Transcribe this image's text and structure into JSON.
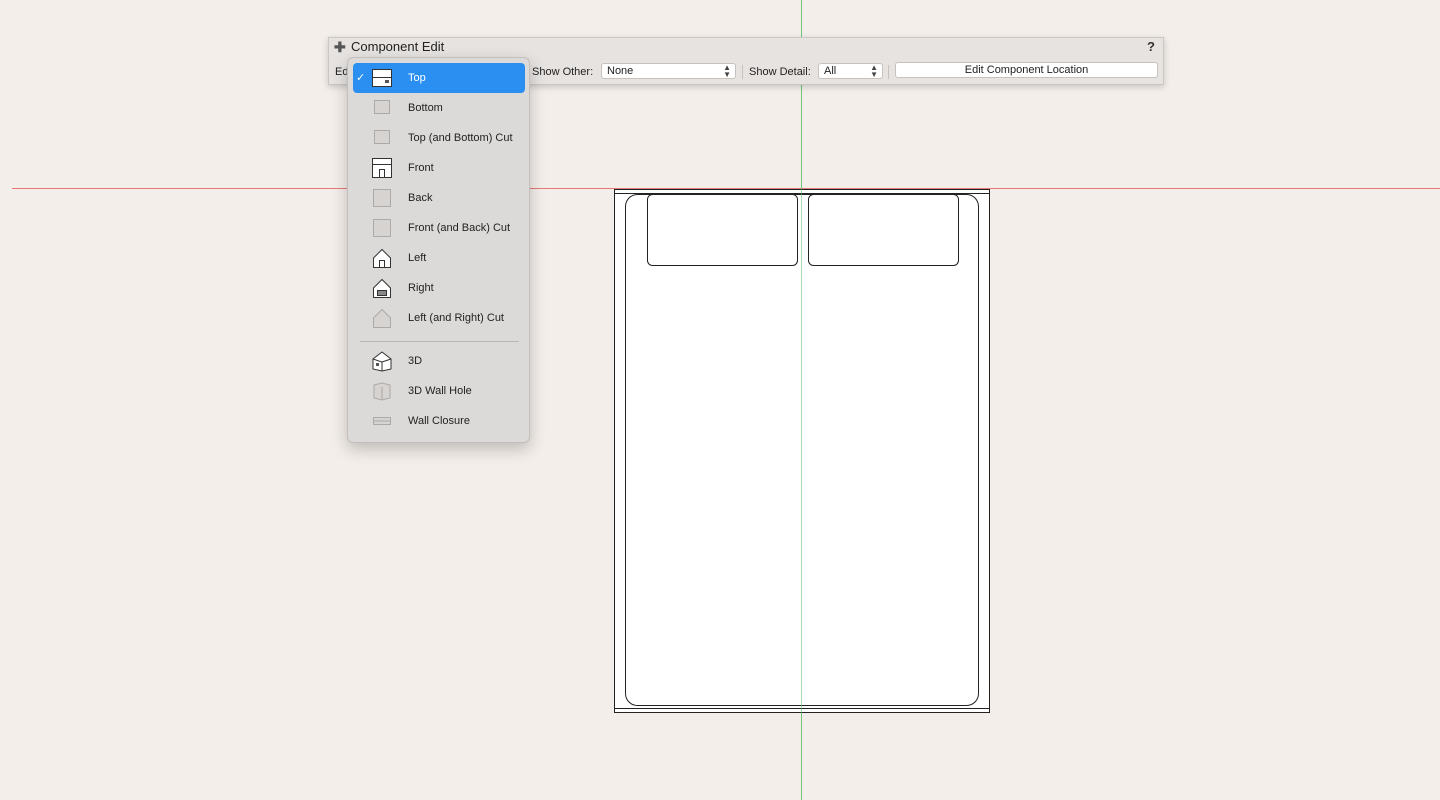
{
  "component_edit": {
    "title": "Component Edit",
    "help_label": "?",
    "edit_label": "Ed",
    "show_other_label": "Show Other:",
    "show_other_value": "None",
    "show_detail_label": "Show Detail:",
    "show_detail_value": "All",
    "edit_location_button": "Edit Component Location"
  },
  "view_menu": {
    "selected": "Top",
    "items": [
      {
        "label": "Top",
        "icon": "top-view-icon"
      },
      {
        "label": "Bottom",
        "icon": "bottom-view-icon"
      },
      {
        "label": "Top (and Bottom) Cut",
        "icon": "top-bottom-cut-icon"
      },
      {
        "label": "Front",
        "icon": "front-view-icon"
      },
      {
        "label": "Back",
        "icon": "back-view-icon"
      },
      {
        "label": "Front (and Back) Cut",
        "icon": "front-back-cut-icon"
      },
      {
        "label": "Left",
        "icon": "left-view-icon"
      },
      {
        "label": "Right",
        "icon": "right-view-icon"
      },
      {
        "label": "Left (and Right) Cut",
        "icon": "left-right-cut-icon"
      },
      {
        "label": "3D",
        "icon": "3d-view-icon"
      },
      {
        "label": "3D Wall Hole",
        "icon": "3d-wall-hole-icon"
      },
      {
        "label": "Wall Closure",
        "icon": "wall-closure-icon"
      }
    ]
  },
  "colors": {
    "background": "#f3eeea",
    "x_axis": "#e05252",
    "y_axis": "#5fc46a",
    "selection": "#2a8ff0"
  }
}
